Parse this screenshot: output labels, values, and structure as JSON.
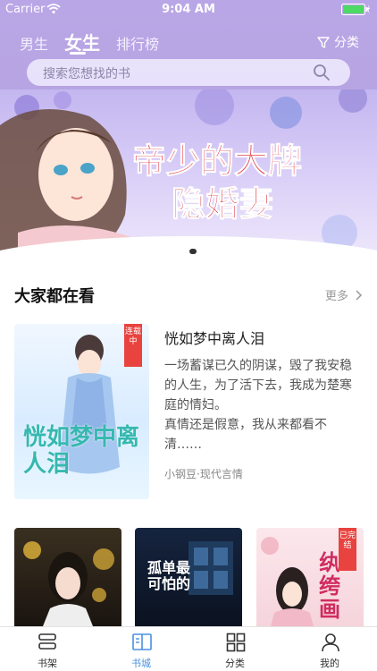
{
  "status_bar": {
    "carrier": "Carrier",
    "time": "9:04 AM"
  },
  "tabs": [
    {
      "label": "男生"
    },
    {
      "label": "女生",
      "active": true
    },
    {
      "label": "排行榜"
    }
  ],
  "category_label": "分类",
  "search": {
    "placeholder": "搜索您想找的书"
  },
  "banner": {
    "title": "帝少的大牌隐婚妻"
  },
  "section": {
    "title": "大家都在看",
    "more_label": "更多"
  },
  "featured": {
    "title": "恍如梦中离人泪",
    "badge": "连载中",
    "cover_text": "恍如梦中离人泪",
    "description": "一场蓄谋已久的阴谋，毁了我安稳的人生，为了活下去，我成为楚寒庭的情妇。\n真情还是假意，我从来都看不清……",
    "meta": "小钢豆·现代言情"
  },
  "books": [
    {
      "cover_text": ""
    },
    {
      "cover_text": "孤单最可怕的"
    },
    {
      "cover_text": "纨绔画",
      "badge": "已完结"
    }
  ],
  "tabbar": [
    {
      "label": "书架",
      "icon": "bookshelf-icon"
    },
    {
      "label": "书城",
      "icon": "bookstore-icon",
      "active": true
    },
    {
      "label": "分类",
      "icon": "grid-icon"
    },
    {
      "label": "我的",
      "icon": "person-icon"
    }
  ],
  "colors": {
    "header": "#b9a6e6",
    "accent": "#4a90e2",
    "battery": "#4cd964"
  }
}
